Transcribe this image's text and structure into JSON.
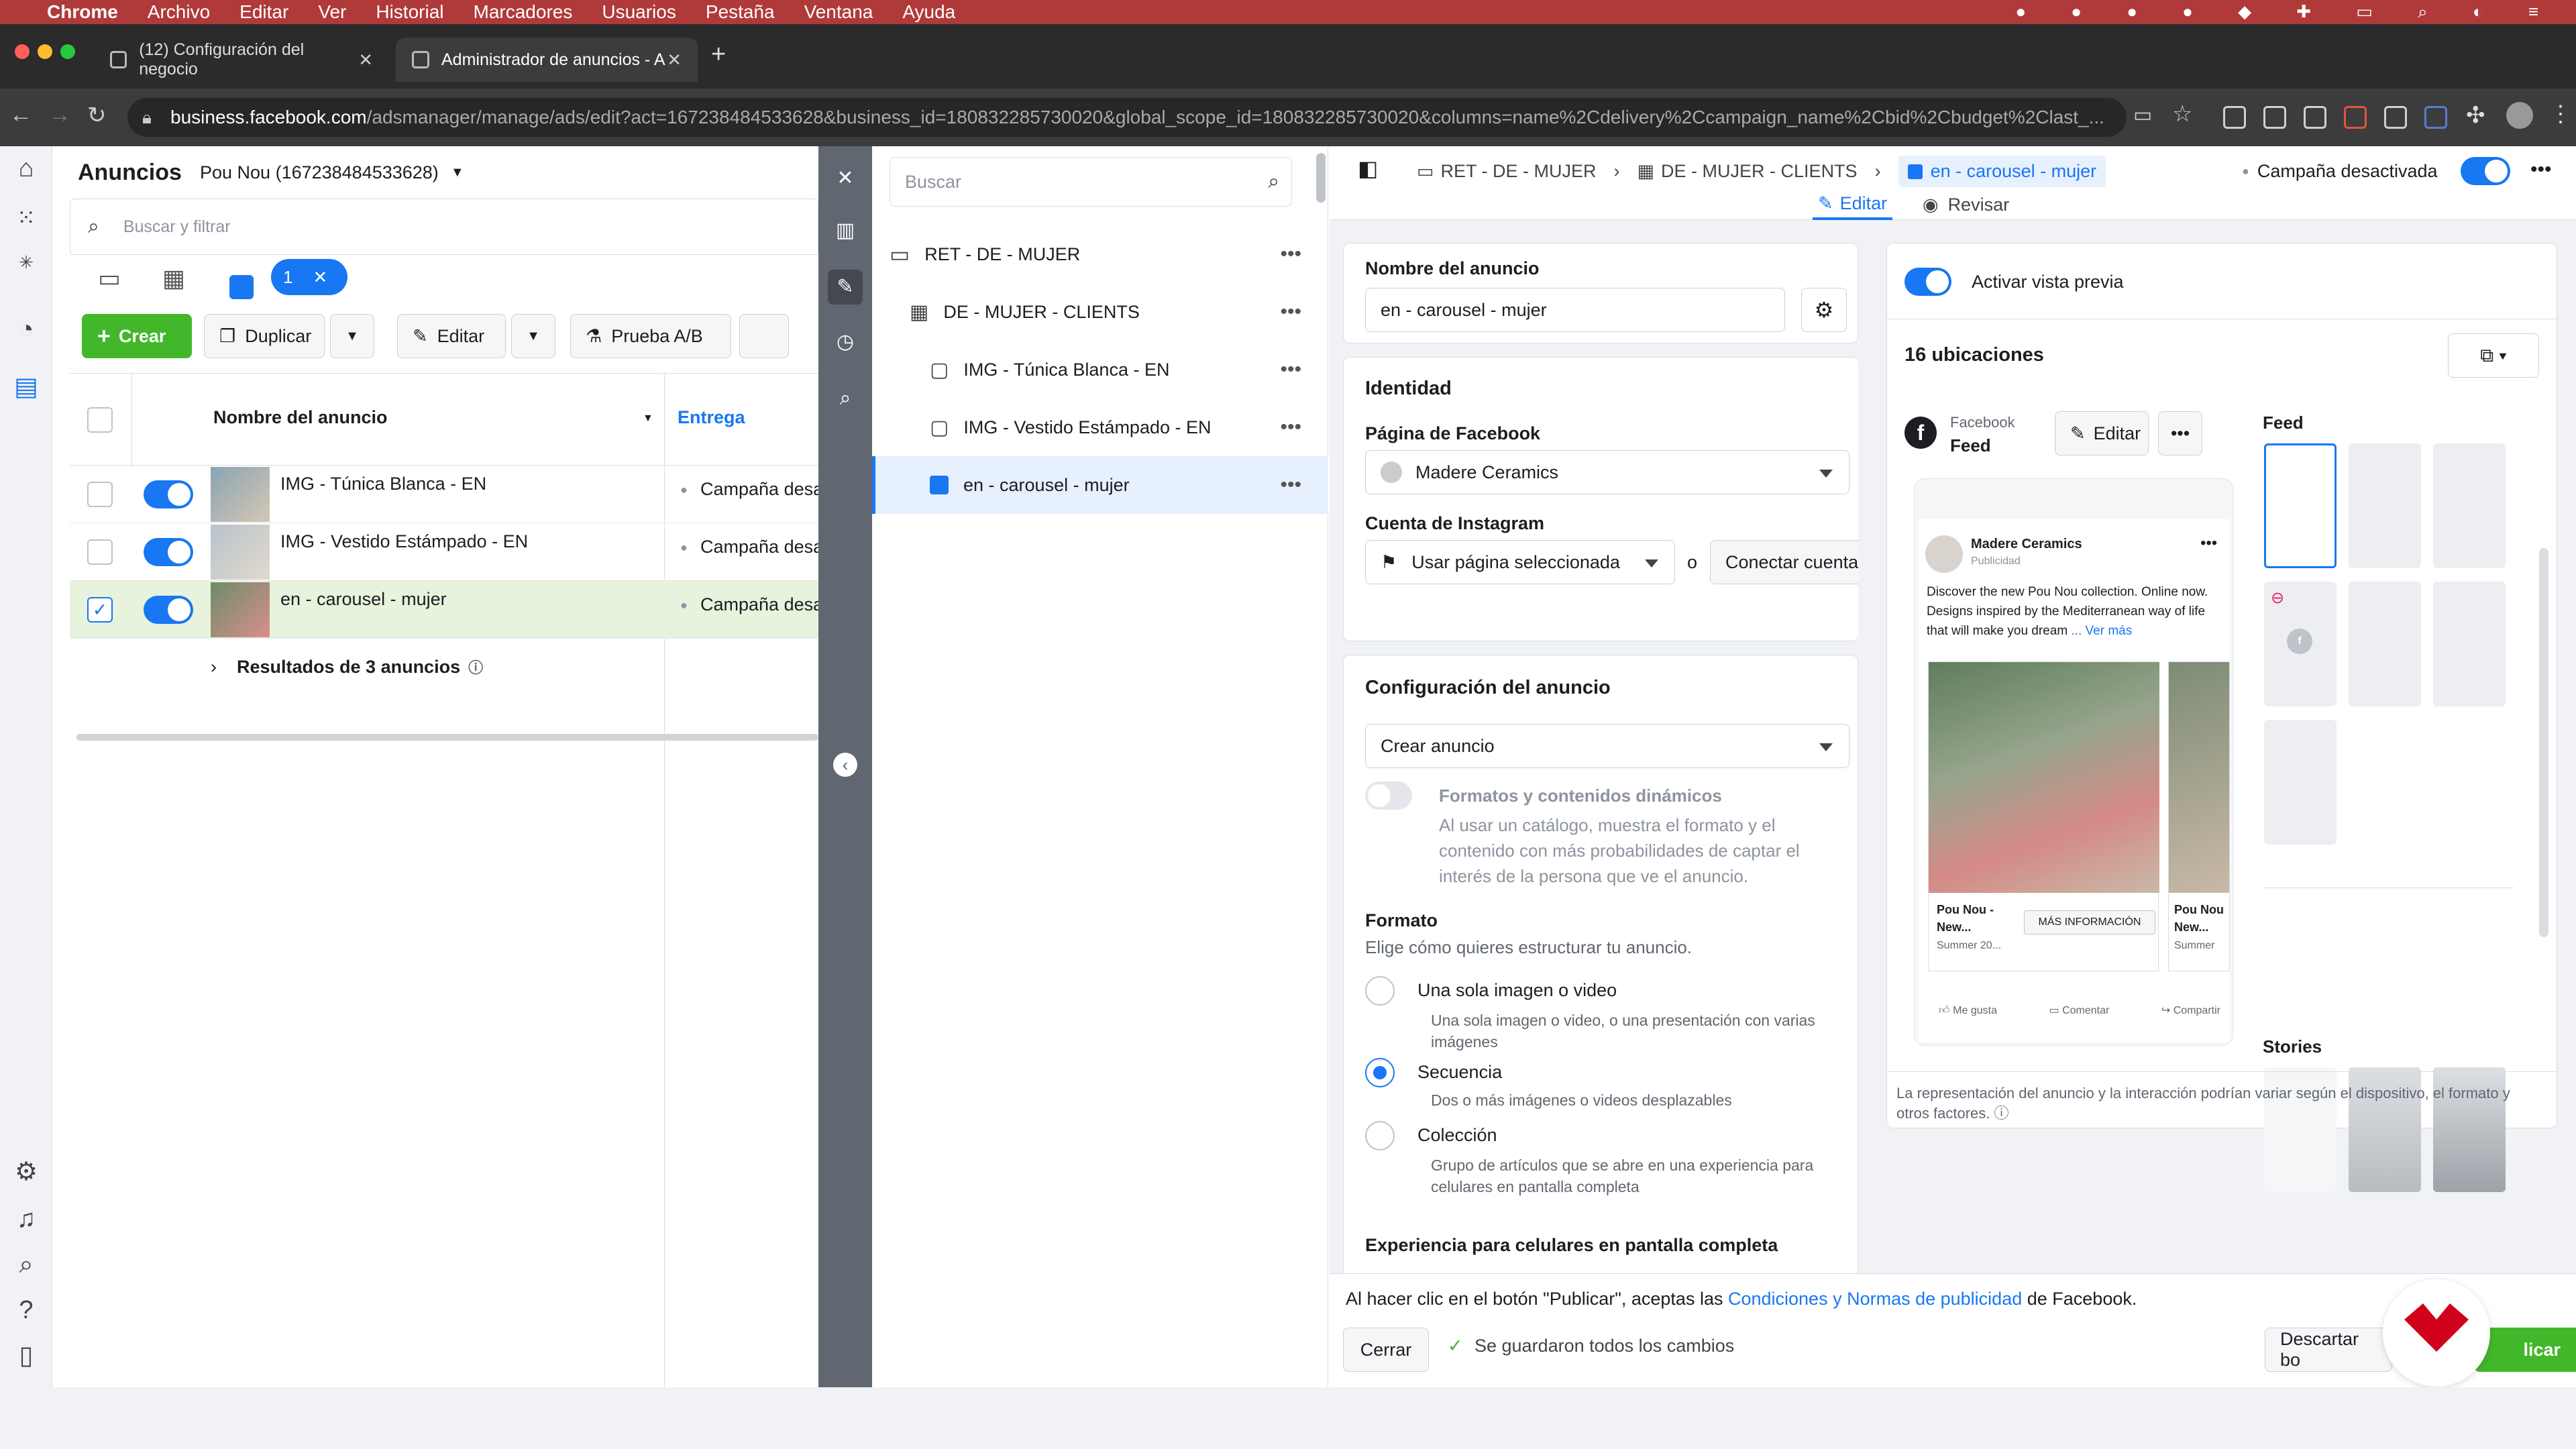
{
  "menubar": {
    "app": "Chrome",
    "items": [
      "Archivo",
      "Editar",
      "Ver",
      "Historial",
      "Marcadores",
      "Usuarios",
      "Pestaña",
      "Ventana",
      "Ayuda"
    ]
  },
  "tabs": [
    {
      "title": "(12) Configuración del negocio"
    },
    {
      "title": "Administrador de anuncios - A"
    }
  ],
  "address": {
    "domain": "business.facebook.com",
    "path": "/adsmanager/manage/ads/edit?act=167238484533628&business_id=180832285730020&global_scope_id=180832285730020&columns=name%2Cdelivery%2Ccampaign_name%2Cbid%2Cbudget%2Clast_..."
  },
  "ads_panel": {
    "title": "Anuncios",
    "account": "Pou Nou (167238484533628)",
    "search_placeholder": "Buscar y filtrar",
    "filter_chip": "1",
    "toolbar": {
      "create": "Crear",
      "duplicate": "Duplicar",
      "edit": "Editar",
      "ab_test": "Prueba A/B"
    },
    "columns": {
      "name": "Nombre del anuncio",
      "delivery": "Entrega"
    },
    "rows": [
      {
        "name": "IMG - Túnica Blanca - EN",
        "delivery": "Campaña desa"
      },
      {
        "name": "IMG - Vestido Estámpado - EN",
        "delivery": "Campaña desa"
      },
      {
        "name": "en - carousel - mujer",
        "delivery": "Campaña desa"
      }
    ],
    "results": "Resultados de 3 anuncios"
  },
  "tree": {
    "search_placeholder": "Buscar",
    "items": [
      {
        "label": "RET - DE - MUJER"
      },
      {
        "label": "DE - MUJER - CLIENTS"
      },
      {
        "label": "IMG - Túnica Blanca - EN"
      },
      {
        "label": "IMG - Vestido Estámpado - EN"
      },
      {
        "label": "en - carousel - mujer"
      }
    ]
  },
  "editor": {
    "breadcrumb": [
      "RET - DE - MUJER",
      "DE - MUJER - CLIENTS",
      "en - carousel - mujer"
    ],
    "campaign_status": "Campaña desactivada",
    "tab_edit": "Editar",
    "tab_review": "Revisar",
    "ad_name_label": "Nombre del anuncio",
    "ad_name_value": "en - carousel - mujer",
    "identity_title": "Identidad",
    "fb_page_label": "Página de Facebook",
    "fb_page_value": "Madere Ceramics",
    "ig_label": "Cuenta de Instagram",
    "ig_value": "Usar página seleccionada",
    "ig_or": "o",
    "ig_connect": "Conectar cuenta",
    "config_title": "Configuración del anuncio",
    "config_value": "Crear anuncio",
    "dynamic_label": "Formatos y contenidos dinámicos",
    "dynamic_desc": "Al usar un catálogo, muestra el formato y el contenido con más probabilidades de captar el interés de la persona que ve el anuncio.",
    "format_title": "Formato",
    "format_sub": "Elige cómo quieres estructurar tu anuncio.",
    "formats": [
      {
        "label": "Una sola imagen o video",
        "desc": "Una sola imagen o video, o una presentación con varias imágenes"
      },
      {
        "label": "Secuencia",
        "desc": "Dos o más imágenes o videos desplazables"
      },
      {
        "label": "Colección",
        "desc": "Grupo de artículos que se abre en una experiencia para celulares en pantalla completa"
      }
    ],
    "fullscreen_title": "Experiencia para celulares en pantalla completa"
  },
  "preview": {
    "toggle_label": "Activar vista previa",
    "placements": "16 ubicaciones",
    "platform": "Facebook",
    "placement": "Feed",
    "edit": "Editar",
    "post": {
      "page": "Madere Ceramics",
      "sponsored": "Publicidad",
      "text": "Discover the new Pou Nou collection. Online now. Designs inspired by the Mediterranean way of life that will make you dream",
      "more": "... Ver más",
      "card1_title": "Pou Nou - New...",
      "card1_sub": "Summer 20...",
      "card_cta": "MÁS INFORMACIÓN",
      "card2_title": "Pou Nou New...",
      "card2_sub": "Summer",
      "like": "Me gusta",
      "comment": "Comentar",
      "share": "Compartir"
    },
    "feed_label": "Feed",
    "stories_label": "Stories",
    "disclaimer": "La representación del anuncio y la interacción podrían variar según el dispositivo, el formato y otros factores."
  },
  "footer": {
    "terms_pre": "Al hacer clic en el botón \"Publicar\", aceptas las",
    "terms_link": "Condiciones y Normas de publicidad",
    "terms_post": "de Facebook.",
    "close": "Cerrar",
    "saved": "Se guardaron todos los cambios",
    "discard": "Descartar bo",
    "publish": "licar"
  }
}
